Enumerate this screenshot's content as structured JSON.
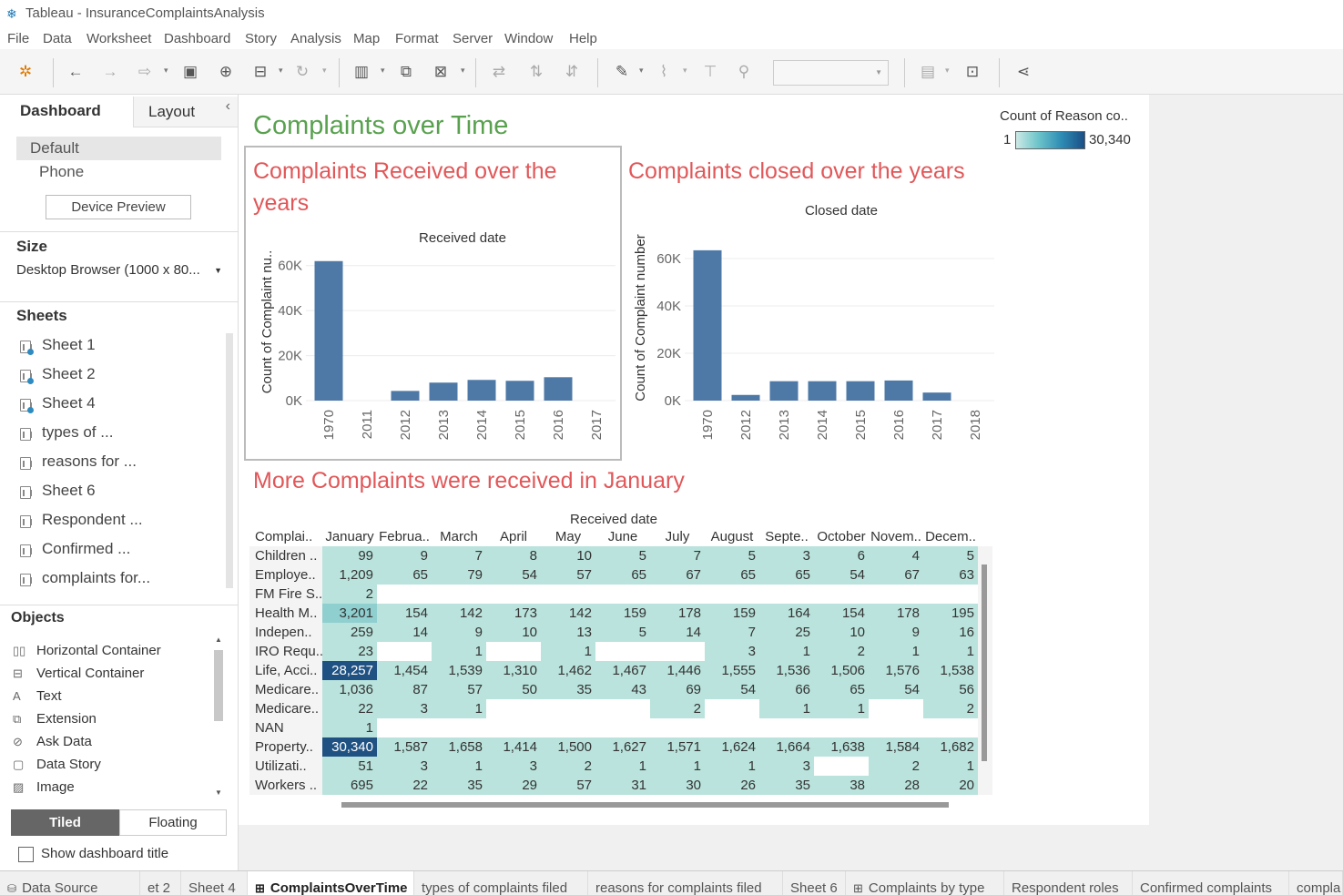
{
  "window": {
    "title": "Tableau - InsuranceComplaintsAnalysis"
  },
  "menu": [
    "File",
    "Data",
    "Worksheet",
    "Dashboard",
    "Story",
    "Analysis",
    "Map",
    "Format",
    "Server",
    "Window",
    "Help"
  ],
  "left_panel": {
    "tab_dashboard": "Dashboard",
    "tab_layout": "Layout",
    "device_default": "Default",
    "device_phone": "Phone",
    "device_preview": "Device Preview",
    "size_heading": "Size",
    "size_value": "Desktop Browser (1000 x 80...",
    "sheets_heading": "Sheets",
    "sheets": [
      {
        "label": "Sheet 1",
        "used": true
      },
      {
        "label": "Sheet 2",
        "used": true
      },
      {
        "label": "Sheet 4",
        "used": true
      },
      {
        "label": "types of ...",
        "used": false
      },
      {
        "label": "reasons for ...",
        "used": false
      },
      {
        "label": "Sheet 6",
        "used": false
      },
      {
        "label": "Respondent ...",
        "used": false
      },
      {
        "label": "Confirmed ...",
        "used": false
      },
      {
        "label": "complaints for...",
        "used": false
      }
    ],
    "objects_heading": "Objects",
    "objects": [
      {
        "label": "Horizontal Container",
        "icon": "horizontal-container-icon"
      },
      {
        "label": "Vertical Container",
        "icon": "vertical-container-icon"
      },
      {
        "label": "Text",
        "icon": "text-icon"
      },
      {
        "label": "Extension",
        "icon": "extension-icon"
      },
      {
        "label": "Ask Data",
        "icon": "ask-data-icon"
      },
      {
        "label": "Data Story",
        "icon": "data-story-icon"
      },
      {
        "label": "Image",
        "icon": "image-icon"
      }
    ],
    "tiled": "Tiled",
    "floating": "Floating",
    "show_title": "Show dashboard title"
  },
  "dashboard": {
    "title": "Complaints over Time",
    "legend": {
      "title": "Count of Reason co..",
      "min": "1",
      "max": "30,340"
    },
    "heatmap_title": "More Complaints were received in January"
  },
  "chart_data": [
    {
      "type": "bar",
      "title": "Complaints Received over the years",
      "xlabel": "Received date",
      "ylabel": "Count of Complaint nu..",
      "categories": [
        "1970",
        "2011",
        "2012",
        "2013",
        "2014",
        "2015",
        "2016",
        "2017"
      ],
      "values": [
        62000,
        0,
        4300,
        8000,
        9200,
        8800,
        10400,
        0
      ],
      "yticks": [
        "0K",
        "20K",
        "40K",
        "60K"
      ],
      "ylim": [
        0,
        70000
      ],
      "color": "#4e79a7"
    },
    {
      "type": "bar",
      "title": "Complaints closed over the years",
      "xlabel": "Closed date",
      "ylabel": "Count of Complaint number",
      "categories": [
        "1970",
        "2012",
        "2013",
        "2014",
        "2015",
        "2016",
        "2017",
        "2018"
      ],
      "values": [
        63500,
        2400,
        8200,
        8200,
        8200,
        8500,
        3400,
        0
      ],
      "yticks": [
        "0K",
        "20K",
        "40K",
        "60K"
      ],
      "ylim": [
        0,
        70000
      ],
      "color": "#4e79a7"
    },
    {
      "type": "heatmap",
      "col_header": "Received date",
      "row_header": "Complai..",
      "columns": [
        "January",
        "Februa..",
        "March",
        "April",
        "May",
        "June",
        "July",
        "August",
        "Septe..",
        "October",
        "Novem..",
        "Decem.."
      ],
      "rows": [
        {
          "label": "Children ..",
          "values": [
            "99",
            "9",
            "7",
            "8",
            "10",
            "5",
            "7",
            "5",
            "3",
            "6",
            "4",
            "5"
          ]
        },
        {
          "label": "Employe..",
          "values": [
            "1,209",
            "65",
            "79",
            "54",
            "57",
            "65",
            "67",
            "65",
            "65",
            "54",
            "67",
            "63"
          ]
        },
        {
          "label": "FM Fire S..",
          "values": [
            "2",
            "",
            "",
            "",
            "",
            "",
            "",
            "",
            "",
            "",
            "",
            ""
          ]
        },
        {
          "label": "Health M..",
          "values": [
            "3,201",
            "154",
            "142",
            "173",
            "142",
            "159",
            "178",
            "159",
            "164",
            "154",
            "178",
            "195"
          ]
        },
        {
          "label": "Indepen..",
          "values": [
            "259",
            "14",
            "9",
            "10",
            "13",
            "5",
            "14",
            "7",
            "25",
            "10",
            "9",
            "16"
          ]
        },
        {
          "label": "IRO Requ..",
          "values": [
            "23",
            "",
            "1",
            "",
            "1",
            "",
            "",
            "3",
            "1",
            "2",
            "1",
            "1"
          ]
        },
        {
          "label": "Life, Acci..",
          "values": [
            "28,257",
            "1,454",
            "1,539",
            "1,310",
            "1,462",
            "1,467",
            "1,446",
            "1,555",
            "1,536",
            "1,506",
            "1,576",
            "1,538"
          ]
        },
        {
          "label": "Medicare..",
          "values": [
            "1,036",
            "87",
            "57",
            "50",
            "35",
            "43",
            "69",
            "54",
            "66",
            "65",
            "54",
            "56"
          ]
        },
        {
          "label": "Medicare..",
          "values": [
            "22",
            "3",
            "1",
            "",
            "",
            "",
            "2",
            "",
            "1",
            "1",
            "",
            "2"
          ]
        },
        {
          "label": "NAN",
          "values": [
            "1",
            "",
            "",
            "",
            "",
            "",
            "",
            "",
            "",
            "",
            "",
            ""
          ]
        },
        {
          "label": "Property..",
          "values": [
            "30,340",
            "1,587",
            "1,658",
            "1,414",
            "1,500",
            "1,627",
            "1,571",
            "1,624",
            "1,664",
            "1,638",
            "1,584",
            "1,682"
          ]
        },
        {
          "label": "Utilizati..",
          "values": [
            "51",
            "3",
            "1",
            "3",
            "2",
            "1",
            "1",
            "1",
            "3",
            "",
            "2",
            "1"
          ]
        },
        {
          "label": "Workers ..",
          "values": [
            "695",
            "22",
            "35",
            "29",
            "57",
            "31",
            "30",
            "26",
            "35",
            "38",
            "28",
            "20"
          ]
        }
      ]
    }
  ],
  "bottom_tabs": [
    {
      "label": "Data Source",
      "active": false
    },
    {
      "label": "et 2",
      "active": false
    },
    {
      "label": "Sheet 4",
      "active": false
    },
    {
      "label": "ComplaintsOverTime",
      "active": true
    },
    {
      "label": "types of complaints filed",
      "active": false
    },
    {
      "label": "reasons for complaints filed",
      "active": false
    },
    {
      "label": "Sheet 6",
      "active": false
    },
    {
      "label": "Complaints by type",
      "active": false
    },
    {
      "label": "Respondent roles",
      "active": false
    },
    {
      "label": "Confirmed complaints",
      "active": false
    },
    {
      "label": "compla",
      "active": false
    }
  ]
}
